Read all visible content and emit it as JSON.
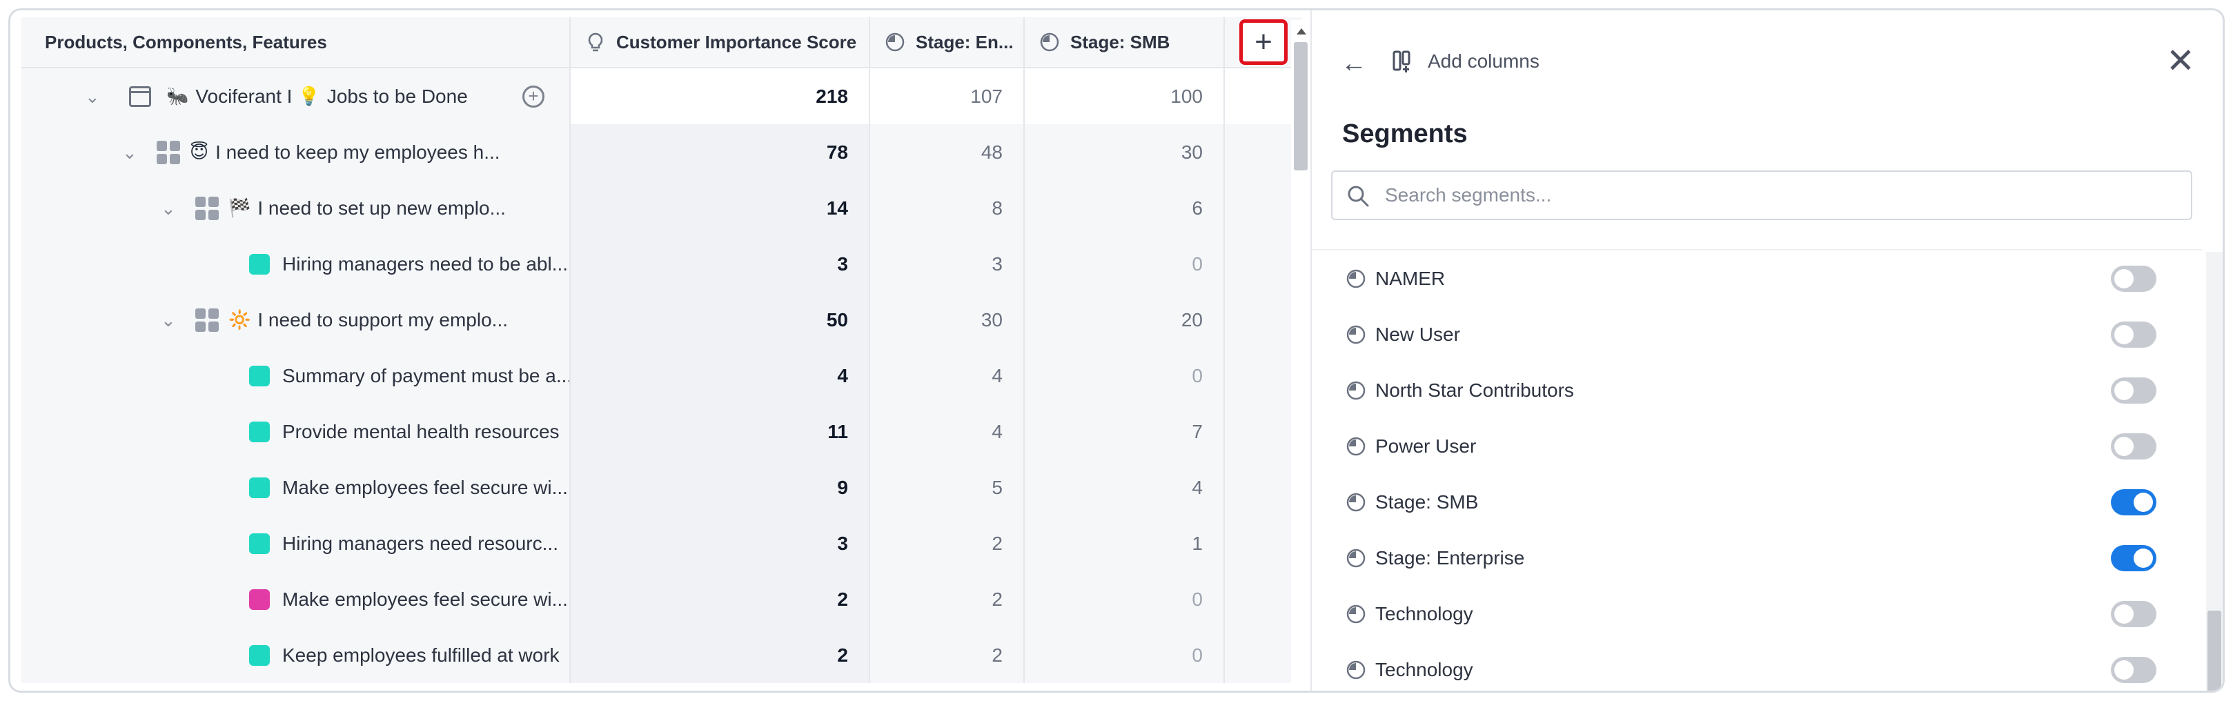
{
  "table": {
    "headers": {
      "name": "Products, Components, Features",
      "score": "Customer Importance Score",
      "enterprise": "Stage: En...",
      "smb": "Stage: SMB",
      "add": "+"
    },
    "rows": [
      {
        "name": "Vociferant I",
        "emoji_a": "🐜",
        "emoji_b": "💡",
        "suffix": "Jobs to be Done",
        "score": "218",
        "ent": "107",
        "smb": "100"
      },
      {
        "name": "I need to keep my employees h...",
        "emoji": "😇",
        "score": "78",
        "ent": "48",
        "smb": "30"
      },
      {
        "name": "I need to set up new emplo...",
        "emoji": "🏁",
        "score": "14",
        "ent": "8",
        "smb": "6"
      },
      {
        "name": "Hiring managers need to be abl...",
        "color": "#1fd8c2",
        "score": "3",
        "ent": "3",
        "smb": "0"
      },
      {
        "name": "I need to support my emplo...",
        "emoji": "🔆",
        "score": "50",
        "ent": "30",
        "smb": "20"
      },
      {
        "name": "Summary of payment must be a...",
        "color": "#1fd8c2",
        "score": "4",
        "ent": "4",
        "smb": "0"
      },
      {
        "name": "Provide mental health resources",
        "color": "#1fd8c2",
        "score": "11",
        "ent": "4",
        "smb": "7"
      },
      {
        "name": "Make employees feel secure wi...",
        "color": "#1fd8c2",
        "score": "9",
        "ent": "5",
        "smb": "4"
      },
      {
        "name": "Hiring managers need resourc...",
        "color": "#1fd8c2",
        "score": "3",
        "ent": "2",
        "smb": "1"
      },
      {
        "name": "Make employees feel secure wi...",
        "color": "#e23ba6",
        "score": "2",
        "ent": "2",
        "smb": "0"
      },
      {
        "name": "Keep employees fulfilled at work",
        "color": "#1fd8c2",
        "score": "2",
        "ent": "2",
        "smb": "0"
      }
    ]
  },
  "panel": {
    "header_label": "Add columns",
    "close": "✕",
    "title": "Segments",
    "search_placeholder": "Search segments...",
    "segments": [
      {
        "label": "NAMER",
        "on": false
      },
      {
        "label": "New User",
        "on": false
      },
      {
        "label": "North Star Contributors",
        "on": false
      },
      {
        "label": "Power User",
        "on": false
      },
      {
        "label": "Stage: SMB",
        "on": true
      },
      {
        "label": "Stage: Enterprise",
        "on": true
      },
      {
        "label": "Technology",
        "on": false
      },
      {
        "label": "Technology",
        "on": false
      }
    ]
  },
  "colors": {
    "accent_toggle": "#1a7ae5",
    "highlight_border": "#e0121d",
    "teal": "#1fd8c2",
    "magenta": "#e23ba6"
  },
  "icons": {
    "back": "arrow-left-icon",
    "columns": "add-columns-icon",
    "close": "close-icon",
    "search": "search-icon",
    "segment": "segment-pie-icon",
    "score": "lightbulb-icon"
  }
}
